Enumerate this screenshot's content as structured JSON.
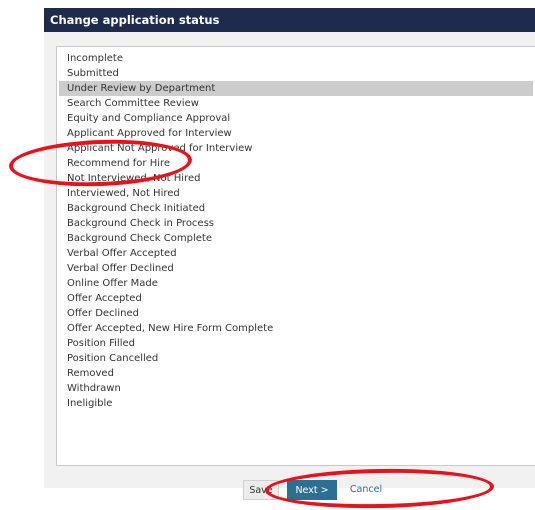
{
  "dialog": {
    "title": "Change application status"
  },
  "status_list": {
    "selected_index": 2,
    "items": [
      "Incomplete",
      "Submitted",
      "Under Review by Department",
      "Search Committee Review",
      "Equity and Compliance Approval",
      "Applicant Approved for Interview",
      "Applicant Not Approved for Interview",
      "Recommend for Hire",
      "Not Interviewed, Not Hired",
      "Interviewed, Not Hired",
      "Background Check Initiated",
      "Background Check in Process",
      "Background Check Complete",
      "Verbal Offer Accepted",
      "Verbal Offer Declined",
      "Online Offer Made",
      "Offer Accepted",
      "Offer Declined",
      "Offer Accepted, New Hire Form Complete",
      "Position Filled",
      "Position Cancelled",
      "Removed",
      "Withdrawn",
      "Ineligible"
    ]
  },
  "buttons": {
    "save_label": "Save",
    "next_label": "Next >",
    "cancel_label": "Cancel"
  },
  "colors": {
    "titlebar": "#1e2b4d",
    "selected_row": "#cccccc",
    "primary_button": "#2d6f93",
    "annotation": "#e8121a"
  }
}
